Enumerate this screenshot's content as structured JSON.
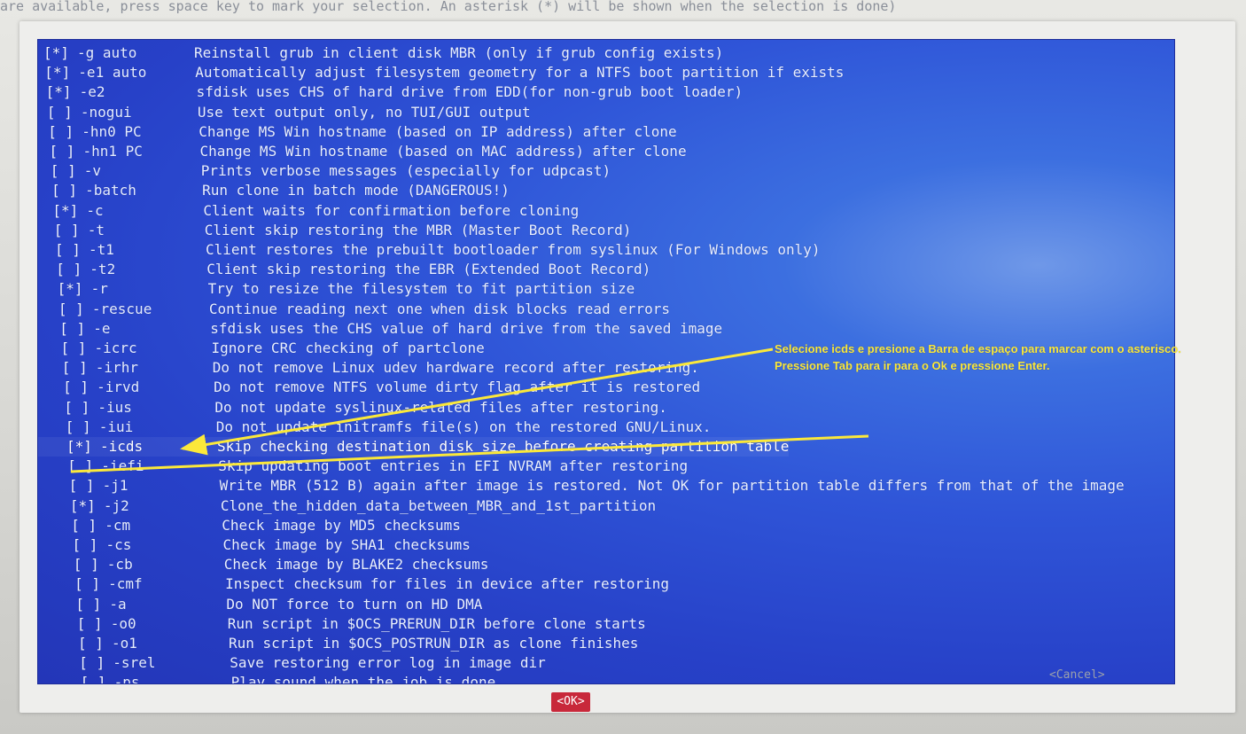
{
  "top_hint": "are available, press space key to mark your selection. An asterisk (*) will be shown when the selection is done)",
  "options": [
    {
      "mark": "[*]",
      "flag": "-g auto",
      "desc": "Reinstall grub in client disk MBR (only if grub config exists)"
    },
    {
      "mark": "[*]",
      "flag": "-e1 auto",
      "desc": "Automatically adjust filesystem geometry for a NTFS boot partition if exists"
    },
    {
      "mark": "[*]",
      "flag": "-e2",
      "desc": "sfdisk uses CHS of hard drive from EDD(for non-grub boot loader)"
    },
    {
      "mark": "[ ]",
      "flag": "-nogui",
      "desc": "Use text output only, no TUI/GUI output"
    },
    {
      "mark": "[ ]",
      "flag": "-hn0 PC",
      "desc": "Change MS Win hostname (based on IP address) after clone"
    },
    {
      "mark": "[ ]",
      "flag": "-hn1 PC",
      "desc": "Change MS Win hostname (based on MAC address) after clone"
    },
    {
      "mark": "[ ]",
      "flag": "-v",
      "desc": "Prints verbose messages (especially for udpcast)"
    },
    {
      "mark": "[ ]",
      "flag": "-batch",
      "desc": "Run clone in batch mode (DANGEROUS!)"
    },
    {
      "mark": "[*]",
      "flag": "-c",
      "desc": "Client waits for confirmation before cloning"
    },
    {
      "mark": "[ ]",
      "flag": "-t",
      "desc": "Client skip restoring the MBR (Master Boot Record)"
    },
    {
      "mark": "[ ]",
      "flag": "-t1",
      "desc": "Client restores the prebuilt bootloader from syslinux (For Windows only)"
    },
    {
      "mark": "[ ]",
      "flag": "-t2",
      "desc": "Client skip restoring the EBR (Extended Boot Record)"
    },
    {
      "mark": "[*]",
      "flag": "-r",
      "desc": "Try to resize the filesystem to fit partition size"
    },
    {
      "mark": "[ ]",
      "flag": "-rescue",
      "desc": "Continue reading next one when disk blocks read errors"
    },
    {
      "mark": "[ ]",
      "flag": "-e",
      "desc": "sfdisk uses the CHS value of hard drive from the saved image"
    },
    {
      "mark": "[ ]",
      "flag": "-icrc",
      "desc": "Ignore CRC checking of partclone"
    },
    {
      "mark": "[ ]",
      "flag": "-irhr",
      "desc": "Do not remove Linux udev hardware record after restoring."
    },
    {
      "mark": "[ ]",
      "flag": "-irvd",
      "desc": "Do not remove NTFS volume dirty flag after it is restored"
    },
    {
      "mark": "[ ]",
      "flag": "-ius",
      "desc": "Do not update syslinux-related files after restoring."
    },
    {
      "mark": "[ ]",
      "flag": "-iui",
      "desc": "Do not update initramfs file(s) on the restored GNU/Linux."
    },
    {
      "mark": "[*]",
      "flag": "-icds",
      "desc": "Skip checking destination disk size before creating partition table"
    },
    {
      "mark": "[ ]",
      "flag": "-iefi",
      "desc": "Skip updating boot entries in EFI NVRAM after restoring"
    },
    {
      "mark": "[ ]",
      "flag": "-j1",
      "desc": "Write MBR (512 B) again after image is restored. Not OK for partition table differs from that of the image"
    },
    {
      "mark": "[*]",
      "flag": "-j2",
      "desc": "Clone_the_hidden_data_between_MBR_and_1st_partition"
    },
    {
      "mark": "[ ]",
      "flag": "-cm",
      "desc": "Check image by MD5 checksums"
    },
    {
      "mark": "[ ]",
      "flag": "-cs",
      "desc": "Check image by SHA1 checksums"
    },
    {
      "mark": "[ ]",
      "flag": "-cb",
      "desc": "Check image by BLAKE2 checksums"
    },
    {
      "mark": "[ ]",
      "flag": "-cmf",
      "desc": "Inspect checksum for files in device after restoring"
    },
    {
      "mark": "[ ]",
      "flag": "-a",
      "desc": "Do NOT force to turn on HD DMA"
    },
    {
      "mark": "[ ]",
      "flag": "-o0",
      "desc": "Run script in $OCS_PRERUN_DIR before clone starts"
    },
    {
      "mark": "[ ]",
      "flag": "-o1",
      "desc": "Run script in $OCS_POSTRUN_DIR as clone finishes"
    },
    {
      "mark": "[ ]",
      "flag": "-srel",
      "desc": "Save restoring error log in image dir"
    },
    {
      "mark": "[ ]",
      "flag": "-ps",
      "desc": "Play sound when the job is done"
    }
  ],
  "buttons": {
    "ok": "<OK>",
    "cancel": "<Cancel>"
  },
  "annotation": {
    "text": "Selecione icds e presione a Barra de espaço para marcar com o asterisco. Pressione Tab para ir para o Ok e pressione Enter."
  },
  "colors": {
    "list_bg": "#2f55d8",
    "ok_bg": "#c8283a",
    "annotation": "#fbe83a"
  }
}
